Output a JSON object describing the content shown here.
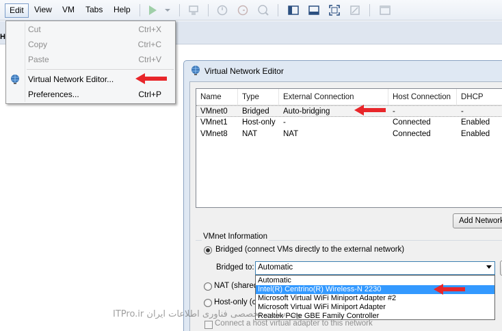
{
  "menubar": {
    "items": [
      {
        "label": "Edit",
        "active": true
      },
      {
        "label": "View"
      },
      {
        "label": "VM"
      },
      {
        "label": "Tabs"
      },
      {
        "label": "Help"
      }
    ],
    "toolbar_icons": [
      "play-icon",
      "dropdown-icon",
      "network-icon",
      "snapshot-take-icon",
      "snapshot-revert-icon",
      "snapshot-manager-icon",
      "sidebar-icon",
      "console-icon",
      "fullscreen-icon",
      "unity-icon",
      "thumbnail-icon"
    ]
  },
  "edit_menu": {
    "items": [
      {
        "label": "Cut",
        "shortcut": "Ctrl+X",
        "enabled": false
      },
      {
        "label": "Copy",
        "shortcut": "Ctrl+C",
        "enabled": false
      },
      {
        "label": "Paste",
        "shortcut": "Ctrl+V",
        "enabled": false
      },
      {
        "label": "Virtual Network Editor...",
        "shortcut": "",
        "enabled": true,
        "icon": "network-globe-icon"
      },
      {
        "label": "Preferences...",
        "shortcut": "Ctrl+P",
        "enabled": true
      }
    ]
  },
  "background": {
    "letter": "H"
  },
  "dialog": {
    "title": "Virtual Network Editor",
    "table": {
      "columns": [
        "Name",
        "Type",
        "External Connection",
        "Host Connection",
        "DHCP"
      ],
      "rows": [
        {
          "name": "VMnet0",
          "type": "Bridged",
          "external": "Auto-bridging",
          "host": "-",
          "dhcp": "-",
          "selected": true
        },
        {
          "name": "VMnet1",
          "type": "Host-only",
          "external": "-",
          "host": "Connected",
          "dhcp": "Enabled"
        },
        {
          "name": "VMnet8",
          "type": "NAT",
          "external": "NAT",
          "host": "Connected",
          "dhcp": "Enabled"
        }
      ]
    },
    "add_network_label": "Add Network",
    "vmnet_info_label": "VMnet Information",
    "bridged_label": "Bridged (connect VMs directly to the external network)",
    "bridged_to_label": "Bridged to:",
    "bridged_to_value": "Automatic",
    "nat_label": "NAT (shared",
    "host_only_label": "Host-only (c",
    "connect_adapter_label": "Connect a host virtual adapter to this network",
    "bridge_options": [
      "Automatic",
      "Intel(R) Centrino(R) Wireless-N 2230",
      "Microsoft Virtual WiFi Miniport Adapter #2",
      "Microsoft Virtual WiFi Miniport Adapter",
      "Realtek PCIe GBE Family Controller"
    ],
    "highlighted_option_index": 1
  },
  "watermark": "وب سایت تخصصی فناوری اطلاعات ایران ITPro.ir",
  "colors": {
    "accent_arrow": "#e8262a",
    "selection": "#3399ff",
    "play_green": "#2db34a"
  }
}
